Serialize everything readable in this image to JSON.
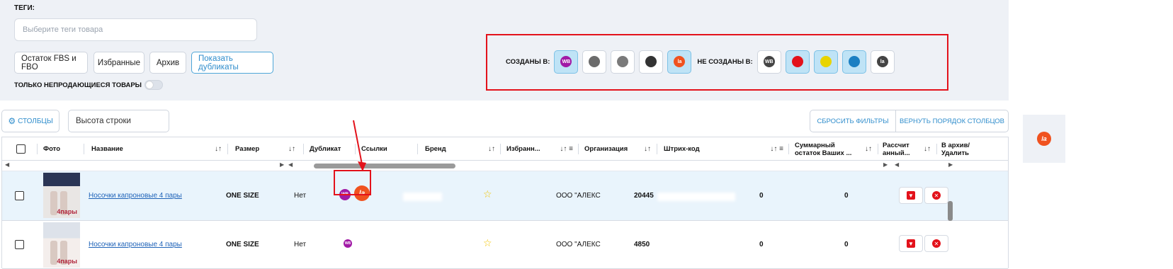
{
  "filters": {
    "tags_label": "ТЕГИ:",
    "tags_placeholder": "Выберите теги товара",
    "chips": [
      "Остаток FBS и FBO",
      "Избранные",
      "Архив",
      "Показать дубликаты"
    ],
    "only_unsold_label": "ТОЛЬКО НЕПРОДАЮЩИЕСЯ ТОВАРЫ",
    "created_in_label": "СОЗДАНЫ В:",
    "not_created_in_label": "НЕ СОЗДАНЫ В:",
    "created_in": [
      {
        "icon": "wb-icon",
        "text": "WB",
        "color": "#a11aa6",
        "selected": true
      },
      {
        "icon": "ozon-icon",
        "text": "",
        "color": "#6b6b6b",
        "selected": false
      },
      {
        "icon": "yandex-icon",
        "text": "",
        "color": "#7a7a7a",
        "selected": false
      },
      {
        "icon": "sber-icon",
        "text": "",
        "color": "#333333",
        "selected": false
      },
      {
        "icon": "lamoda-icon",
        "text": "la",
        "color": "#f0521f",
        "selected": true
      }
    ],
    "not_created_in": [
      {
        "icon": "wb-icon",
        "text": "WB",
        "color": "#444444",
        "selected": false
      },
      {
        "icon": "ozon-icon",
        "text": "",
        "color": "#e3121b",
        "selected": true
      },
      {
        "icon": "yandex-icon",
        "text": "",
        "color": "#e8d400",
        "selected": true
      },
      {
        "icon": "sber-icon",
        "text": "",
        "color": "#1c7fc2",
        "selected": true
      },
      {
        "icon": "lamoda-icon",
        "text": "la",
        "color": "#444444",
        "selected": false
      }
    ]
  },
  "toolbar": {
    "columns_label": "СТОЛБЦЫ",
    "row_height_label": "Высота строки",
    "reset_filters_label": "СБРОСИТЬ ФИЛЬТРЫ",
    "restore_columns_label": "ВЕРНУТЬ ПОРЯДОК СТОЛБЦОВ"
  },
  "table": {
    "columns": {
      "photo": "Фото",
      "name": "Название",
      "size": "Размер",
      "duplicate": "Дубликат",
      "links": "Ссылки",
      "brand": "Бренд",
      "favorite": "Избранн...",
      "organization": "Организация",
      "barcode": "Штрих-код",
      "total_stock_1": "Суммарный",
      "total_stock_2": "остаток Ваших ...",
      "calc_1": "Рассчит",
      "calc_2": "анный...",
      "archive_1": "В архив/",
      "archive_2": "Удалить"
    },
    "sort_glyph": "↓↑",
    "sort_filter_glyph": "↓↑ ≡",
    "rows": [
      {
        "name": "Носочки капроновые 4 пары",
        "size": "ONE SIZE",
        "duplicate": "Нет",
        "organization": "ООО \"АЛЕКС",
        "barcode": "20445",
        "total_stock": "0",
        "calculated": "0"
      },
      {
        "name": "Носочки капроновые 4 пары",
        "size": "ONE SIZE",
        "duplicate": "Нет",
        "organization": "ООО \"АЛЕКС",
        "barcode": "4850",
        "total_stock": "0",
        "calculated": "0"
      }
    ],
    "photo_tag": "4пары"
  },
  "side_tile_icon": "lamoda-icon",
  "side_tile_text": "la",
  "colors": {
    "accent": "#2f8dcc",
    "highlight": "#e3121b",
    "panel": "#eef1f6",
    "selected_row": "#e9f4fc"
  }
}
